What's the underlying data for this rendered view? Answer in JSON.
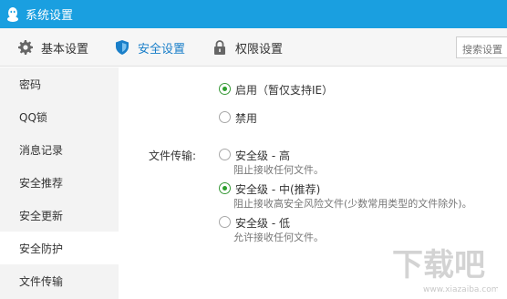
{
  "window": {
    "title": "系统设置"
  },
  "toolbar": {
    "tabs": [
      {
        "label": "基本设置",
        "icon": "gear-icon"
      },
      {
        "label": "安全设置",
        "icon": "shield-icon",
        "active": true
      },
      {
        "label": "权限设置",
        "icon": "lock-icon"
      }
    ],
    "search_placeholder": "搜索设置"
  },
  "sidebar": {
    "items": [
      {
        "label": "密码"
      },
      {
        "label": "QQ锁"
      },
      {
        "label": "消息记录"
      },
      {
        "label": "安全推荐"
      },
      {
        "label": "安全更新"
      },
      {
        "label": "安全防护",
        "active": true
      },
      {
        "label": "文件传输"
      }
    ]
  },
  "protection": {
    "enable_label": "启用（暂仅支持IE）",
    "enable_checked": true,
    "disable_label": "禁用",
    "disable_checked": false
  },
  "transfer": {
    "label": "文件传输:",
    "options": [
      {
        "label": "安全级 - 高",
        "desc": "阻止接收任何文件。",
        "checked": false
      },
      {
        "label": "安全级 - 中(推荐)",
        "desc": "阻止接收高安全风险文件(少数常用类型的文件除外)。",
        "checked": true
      },
      {
        "label": "安全级 - 低",
        "desc": "允许接收任何文件。",
        "checked": false
      }
    ]
  },
  "watermark": {
    "text": "下载吧",
    "url_text": "www.xiazaiba.com"
  },
  "colors": {
    "titlebar": "#1a9fe0",
    "accent": "#1a7fc9",
    "radio_checked": "#2ea02e"
  }
}
